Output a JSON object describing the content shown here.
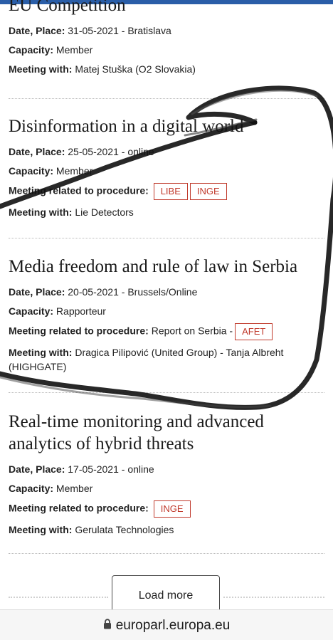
{
  "entries": [
    {
      "title": "EU Competition",
      "date_label": "Date, Place:",
      "date_value": "31-05-2021 - Bratislava",
      "capacity_label": "Capacity:",
      "capacity_value": "Member",
      "meeting_label": "Meeting with:",
      "meeting_value": "Matej Stuška (O2 Slovakia)"
    },
    {
      "title": "Disinformation in a digital world",
      "date_label": "Date, Place:",
      "date_value": "25-05-2021 - online",
      "capacity_label": "Capacity:",
      "capacity_value": "Member",
      "procedure_label": "Meeting related to procedure:",
      "tags": [
        "LIBE",
        "INGE"
      ],
      "meeting_label": "Meeting with:",
      "meeting_value": "Lie Detectors"
    },
    {
      "title": "Media freedom and rule of law in Serbia",
      "date_label": "Date, Place:",
      "date_value": "20-05-2021 - Brussels/Online",
      "capacity_label": "Capacity:",
      "capacity_value": "Rapporteur",
      "procedure_label": "Meeting related to procedure:",
      "procedure_value": "Report on Serbia -",
      "tags": [
        "AFET"
      ],
      "meeting_label": "Meeting with:",
      "meeting_value": "Dragica Pilipović (United Group) - Tanja Albreht (HIGHGATE)"
    },
    {
      "title": "Real-time monitoring and advanced analytics of hybrid threats",
      "date_label": "Date, Place:",
      "date_value": "17-05-2021 - online",
      "capacity_label": "Capacity:",
      "capacity_value": "Member",
      "procedure_label": "Meeting related to procedure:",
      "tags": [
        "INGE"
      ],
      "meeting_label": "Meeting with:",
      "meeting_value": "Gerulata Technologies"
    }
  ],
  "load_more_label": "Load more",
  "url_bar": {
    "url": "europarl.europa.eu",
    "icon": "lock-icon"
  },
  "colors": {
    "tag": "#c0392b",
    "top_bar": "#2a5ea8",
    "scribble": "#111111"
  }
}
